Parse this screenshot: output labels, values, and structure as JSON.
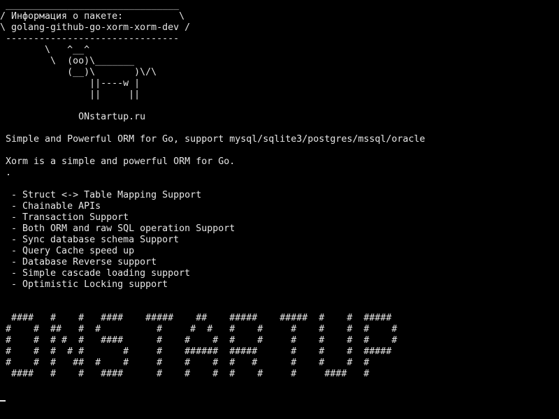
{
  "terminal": {
    "lines": [
      " _______________________________",
      "/ Информация о пакете:          \\",
      "\\ golang-github-go-xorm-xorm-dev /",
      " -------------------------------",
      "        \\   ^__^",
      "         \\  (oo)\\_______",
      "            (__)\\       )\\/\\",
      "                ||----w |",
      "                ||     ||",
      "",
      "              ONstartup.ru",
      "",
      " Simple and Powerful ORM for Go, support mysql/sqlite3/postgres/mssql/oracle",
      "",
      " Xorm is a simple and powerful ORM for Go.",
      " .",
      "",
      "  - Struct <-> Table Mapping Support",
      "  - Chainable APIs",
      "  - Transaction Support",
      "  - Both ORM and raw SQL operation Support",
      "  - Sync database schema Support",
      "  - Query Cache speed up",
      "  - Database Reverse support",
      "  - Simple cascade loading support",
      "  - Optimistic Locking support",
      "",
      "",
      "  ####   #    #   ####    #####    ##    #####    #####  #    #  #####",
      " #    #  ##   #  #          #     #  #   #    #     #    #    #  #    #",
      " #    #  # #  #   ####      #    #    #  #    #     #    #    #  #    #",
      " #    #  #  # #       #     #    ######  #####      #    #    #  #####",
      " #    #  #   ##  #    #     #    #    #  #   #      #    #    #  #",
      "  ####   #    #   ####      #    #    #  #    #     #     ####   #"
    ]
  }
}
